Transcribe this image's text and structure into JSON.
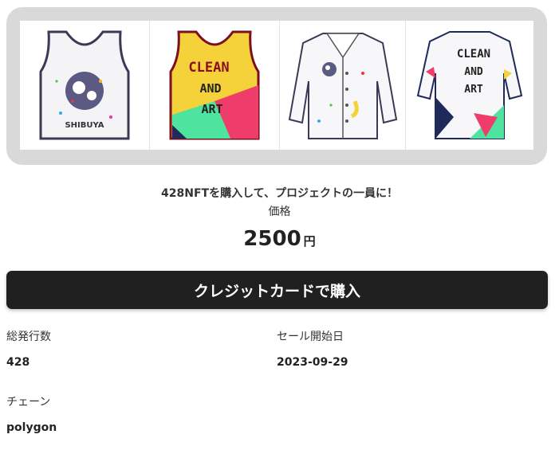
{
  "gallery": {
    "items": [
      {
        "name": "tank-top-white",
        "text_lines": [
          "SHIBUYA"
        ]
      },
      {
        "name": "tank-top-color",
        "text_lines": [
          "CLEAN",
          "AND",
          "ART"
        ]
      },
      {
        "name": "lab-coat-front",
        "text_lines": []
      },
      {
        "name": "lab-coat-back",
        "text_lines": [
          "CLEAN",
          "AND",
          "ART"
        ]
      }
    ]
  },
  "product": {
    "tagline": "428NFTを購入して、プロジェクトの一員に！",
    "price_label": "価格",
    "price_value": "2500",
    "price_unit": "円"
  },
  "buy_button": {
    "label": "クレジットカードで購入"
  },
  "details": {
    "total_issued_label": "総発行数",
    "total_issued_value": "428",
    "sale_start_label": "セール開始日",
    "sale_start_value": "2023-09-29",
    "chain_label": "チェーン",
    "chain_value": "polygon"
  },
  "colors": {
    "button_bg": "#202020",
    "frame_bg": "#d9d9d9",
    "accent_yellow": "#f5d23a",
    "accent_pink": "#ef3d6b",
    "accent_green": "#4fe3a0",
    "accent_navy": "#1f2a5a"
  }
}
